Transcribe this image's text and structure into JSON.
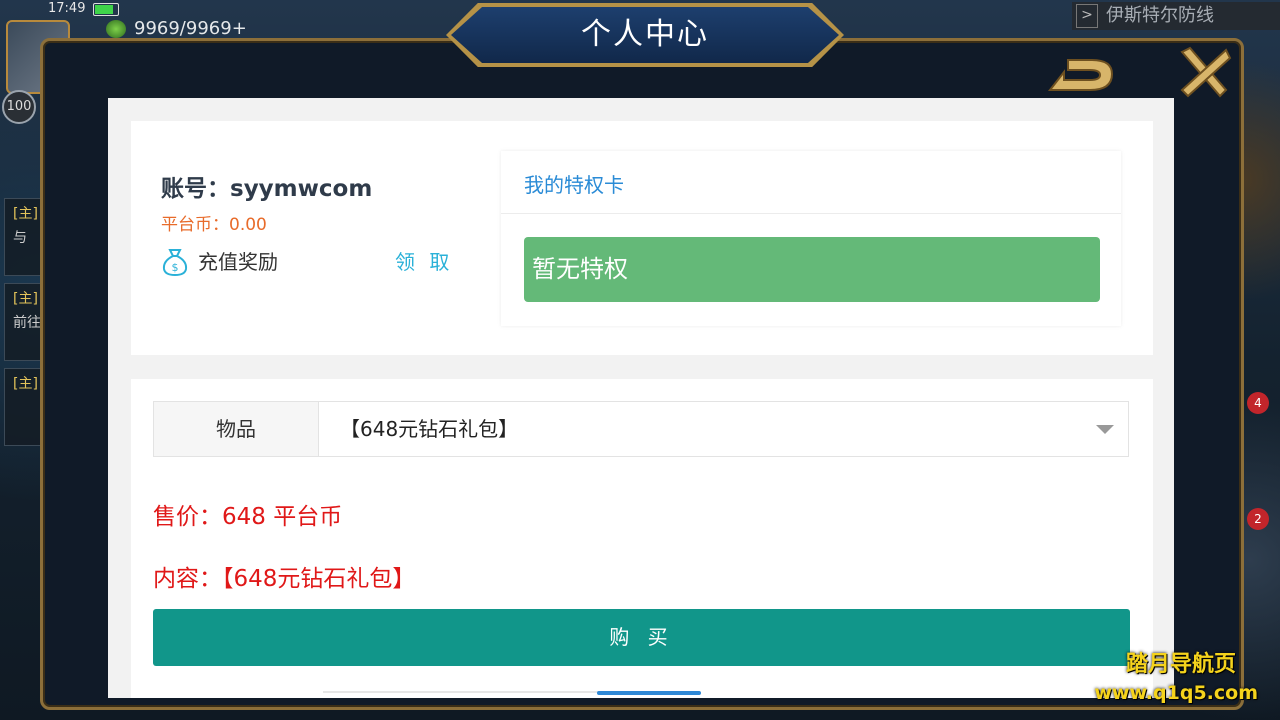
{
  "status": {
    "time": "17:49",
    "battery_level": 0.85
  },
  "game": {
    "stamina": "9969/9969",
    "stamina_plus": "+",
    "level": "100",
    "region_arrow": ">",
    "region": "伊斯特尔防线",
    "side_tasks": [
      {
        "tag": "[主]",
        "text": "与"
      },
      {
        "tag": "[主]",
        "text": "前往"
      },
      {
        "tag": "[主]",
        "text": ""
      }
    ],
    "side_badges": [
      "4",
      "2"
    ]
  },
  "modal": {
    "title": "个人中心",
    "account": {
      "label": "账号：syymwcom",
      "coins": "平台币：0.00",
      "reward_label": "充值奖励",
      "claim_label": "领 取"
    },
    "privilege": {
      "title": "我的特权卡",
      "empty_text": "暂无特权"
    },
    "shop": {
      "item_label": "物品",
      "item_value": "【648元钻石礼包】",
      "price_text": "售价：648 平台币",
      "content_text": "内容：【648元钻石礼包】",
      "buy_label": "购 买"
    }
  },
  "watermark": {
    "title": "踏月导航页",
    "url": "www.q1q5.com"
  },
  "colors": {
    "accent": "#11968a",
    "privilege_green": "#64b978",
    "price_red": "#e01818",
    "coin_orange": "#e86b2a",
    "link_blue": "#2ab1d8"
  }
}
